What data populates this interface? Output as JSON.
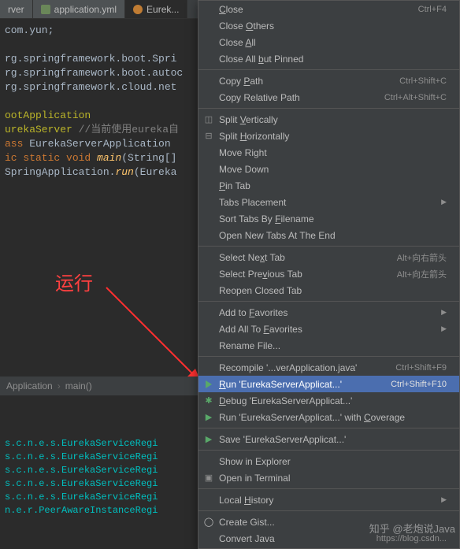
{
  "tabs": [
    {
      "label": "rver"
    },
    {
      "label": "application.yml"
    },
    {
      "label": "Eurek..."
    }
  ],
  "code": {
    "l1a": "com.yun",
    "l1b": ";",
    "l3a": "rg.springframework.boot.Spri",
    "l4a": "rg.springframework.boot.autoc",
    "l5a": "rg.springframework.cloud.net",
    "l7": "ootApplication",
    "l8a": "urekaServer",
    "l8b": " //当前使用eureka自",
    "l9a": "ass ",
    "l9b": "EurekaServerApplication",
    "l10a": "ic static void ",
    "l10b": "main",
    "l10c": "(String[]",
    "l11a": "SpringApplication.",
    "l11b": "run",
    "l11c": "(Eureka"
  },
  "label_run": "运行",
  "breadcrumbs": {
    "a": "Application",
    "b": "main()"
  },
  "console": [
    "s.c.n.e.s.EurekaServiceRegi",
    "s.c.n.e.s.EurekaServiceRegi",
    "s.c.n.e.s.EurekaServiceRegi",
    "s.c.n.e.s.EurekaServiceRegi",
    "s.c.n.e.s.EurekaServiceRegi",
    "n.e.r.PeerAwareInstanceRegi"
  ],
  "menu": [
    {
      "type": "item",
      "label": "Close",
      "shortcut": "Ctrl+F4",
      "u": "C"
    },
    {
      "type": "item",
      "label": "Close Others",
      "u": "O"
    },
    {
      "type": "item",
      "label": "Close All",
      "u": "A"
    },
    {
      "type": "item",
      "label": "Close All but Pinned",
      "u": "b"
    },
    {
      "type": "sep"
    },
    {
      "type": "item",
      "label": "Copy Path",
      "shortcut": "Ctrl+Shift+C",
      "u": "P"
    },
    {
      "type": "item",
      "label": "Copy Relative Path",
      "shortcut": "Ctrl+Alt+Shift+C"
    },
    {
      "type": "sep"
    },
    {
      "type": "item",
      "label": "Split Vertically",
      "icon": "splitv",
      "u": "V"
    },
    {
      "type": "item",
      "label": "Split Horizontally",
      "icon": "splith",
      "u": "H"
    },
    {
      "type": "item",
      "label": "Move Right"
    },
    {
      "type": "item",
      "label": "Move Down"
    },
    {
      "type": "item",
      "label": "Pin Tab",
      "u": "P"
    },
    {
      "type": "item",
      "label": "Tabs Placement",
      "submenu": true
    },
    {
      "type": "item",
      "label": "Sort Tabs By Filename",
      "u": "F"
    },
    {
      "type": "item",
      "label": "Open New Tabs At The End"
    },
    {
      "type": "sep"
    },
    {
      "type": "item",
      "label": "Select Next Tab",
      "shortcut": "Alt+向右箭头",
      "u": "x"
    },
    {
      "type": "item",
      "label": "Select Previous Tab",
      "shortcut": "Alt+向左箭头",
      "u": "v"
    },
    {
      "type": "item",
      "label": "Reopen Closed Tab"
    },
    {
      "type": "sep"
    },
    {
      "type": "item",
      "label": "Add to Favorites",
      "submenu": true,
      "u": "F"
    },
    {
      "type": "item",
      "label": "Add All To Favorites",
      "submenu": true,
      "u": "F"
    },
    {
      "type": "item",
      "label": "Rename File..."
    },
    {
      "type": "sep"
    },
    {
      "type": "item",
      "label": "Recompile '...verApplication.java'",
      "shortcut": "Ctrl+Shift+F9"
    },
    {
      "type": "item",
      "label": "Run 'EurekaServerApplicat...'",
      "shortcut": "Ctrl+Shift+F10",
      "icon": "run",
      "selected": true,
      "u": "R"
    },
    {
      "type": "item",
      "label": "Debug 'EurekaServerApplicat...'",
      "icon": "debug",
      "u": "D"
    },
    {
      "type": "item",
      "label": "Run 'EurekaServerApplicat...' with Coverage",
      "icon": "cover",
      "u": "C"
    },
    {
      "type": "sep"
    },
    {
      "type": "item",
      "label": "Save 'EurekaServerApplicat...'",
      "icon": "save"
    },
    {
      "type": "sep"
    },
    {
      "type": "item",
      "label": "Show in Explorer"
    },
    {
      "type": "item",
      "label": "Open in Terminal",
      "icon": "term"
    },
    {
      "type": "sep"
    },
    {
      "type": "item",
      "label": "Local History",
      "submenu": true,
      "u": "H"
    },
    {
      "type": "sep"
    },
    {
      "type": "item",
      "label": "Create Gist...",
      "icon": "gh"
    },
    {
      "type": "item",
      "label": "Convert Java",
      "mute_suffix": "https://blog.csdn..."
    }
  ],
  "watermark": "知乎 @老炮说Java"
}
